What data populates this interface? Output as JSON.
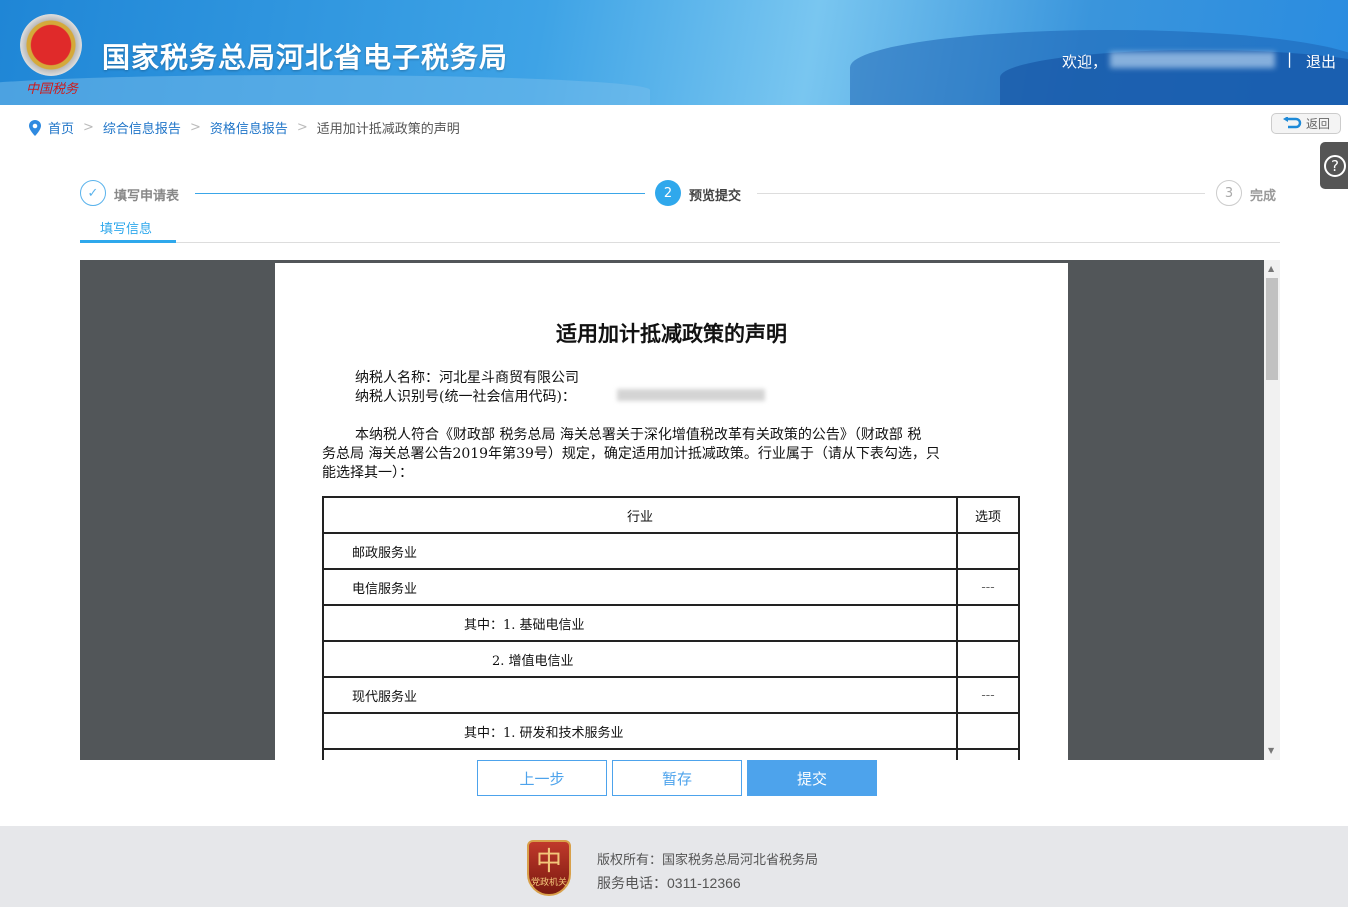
{
  "header": {
    "emblem_text": "中国税务",
    "title": "国家税务总局河北省电子税务局",
    "welcome": "欢迎，",
    "separator": "|",
    "logout": "退出"
  },
  "breadcrumb": {
    "items": [
      "首页",
      "综合信息报告",
      "资格信息报告"
    ],
    "current": "适用加计抵减政策的声明",
    "separator": ">"
  },
  "back_button": "返回",
  "help_icon": "?",
  "steps": [
    {
      "num": "✓",
      "label": "填写申请表"
    },
    {
      "num": "2",
      "label": "预览提交"
    },
    {
      "num": "3",
      "label": "完成"
    }
  ],
  "tab": "填写信息",
  "document": {
    "title": "适用加计抵减政策的声明",
    "taxpayer_name": "纳税人名称：河北星斗商贸有限公司",
    "taxpayer_id_label": "纳税人识别号(统一社会信用代码)：",
    "para1": "本纳税人符合《财政部 税务总局 海关总署关于深化增值税改革有关政策的公告》（财政部 税",
    "para2": "务总局 海关总署公告2019年第39号）规定，确定适用加计抵减政策。行业属于（请从下表勾选，只",
    "para3": "能选择其一）：",
    "table_headers": [
      "行业",
      "选项"
    ],
    "rows": [
      {
        "name": "邮政服务业",
        "indent": 0,
        "opt": ""
      },
      {
        "name": "电信服务业",
        "indent": 0,
        "opt": "---"
      },
      {
        "name": "其中：1. 基础电信业",
        "indent": 1,
        "opt": ""
      },
      {
        "name": "2. 增值电信业",
        "indent": 2,
        "opt": ""
      },
      {
        "name": "现代服务业",
        "indent": 0,
        "opt": "---"
      },
      {
        "name": "其中：1. 研发和技术服务业",
        "indent": 1,
        "opt": ""
      },
      {
        "name": "",
        "indent": 0,
        "opt": ""
      }
    ]
  },
  "buttons": {
    "prev": "上一步",
    "save": "暂存",
    "submit": "提交"
  },
  "footer": {
    "badge": "党政机关",
    "copyright": "版权所有：国家税务总局河北省税务局",
    "phone": "服务电话：0311-12366"
  },
  "colors": {
    "primary": "#4da3ec",
    "step_active": "#2fa8ec"
  }
}
